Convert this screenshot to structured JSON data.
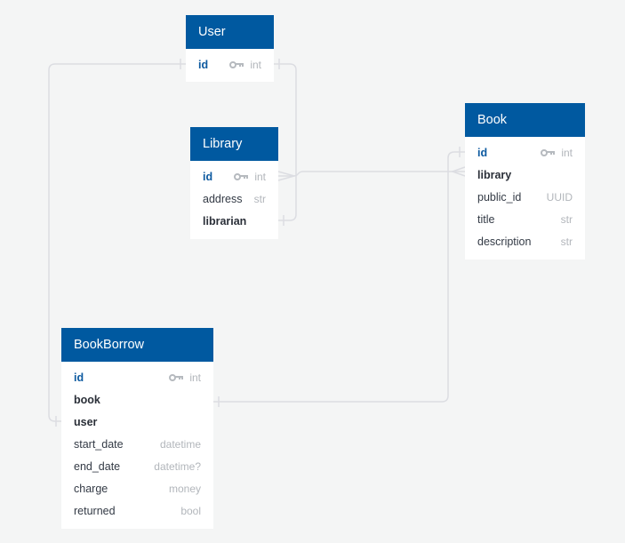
{
  "colors": {
    "header_bg": "#0059a0",
    "header_text": "#ffffff",
    "primary_key_text": "#0d5aa0",
    "type_text": "#b2b6bb",
    "connector": "#dcdde2",
    "canvas_bg": "#f4f5f5"
  },
  "tables": {
    "user": {
      "title": "User",
      "fields": [
        {
          "name": "id",
          "type": "int",
          "pk": true
        }
      ]
    },
    "library": {
      "title": "Library",
      "fields": [
        {
          "name": "id",
          "type": "int",
          "pk": true
        },
        {
          "name": "address",
          "type": "str"
        },
        {
          "name": "librarian",
          "type": "",
          "fk": true
        }
      ]
    },
    "book": {
      "title": "Book",
      "fields": [
        {
          "name": "id",
          "type": "int",
          "pk": true
        },
        {
          "name": "library",
          "type": "",
          "fk": true
        },
        {
          "name": "public_id",
          "type": "UUID"
        },
        {
          "name": "title",
          "type": "str"
        },
        {
          "name": "description",
          "type": "str"
        }
      ]
    },
    "bookborrow": {
      "title": "BookBorrow",
      "fields": [
        {
          "name": "id",
          "type": "int",
          "pk": true
        },
        {
          "name": "book",
          "type": "",
          "fk": true
        },
        {
          "name": "user",
          "type": "",
          "fk": true
        },
        {
          "name": "start_date",
          "type": "datetime"
        },
        {
          "name": "end_date",
          "type": "datetime?"
        },
        {
          "name": "charge",
          "type": "money"
        },
        {
          "name": "returned",
          "type": "bool"
        }
      ]
    }
  },
  "relationships": [
    {
      "from": "User.id",
      "to": "BookBorrow.user",
      "from_end": "one",
      "to_end": "one"
    },
    {
      "from": "User.id",
      "to": "Library.librarian",
      "from_end": "one",
      "to_end": "one"
    },
    {
      "from": "Library.id",
      "to": "Book.library",
      "from_end": "many",
      "to_end": "many"
    },
    {
      "from": "Book.id",
      "to": "BookBorrow.book",
      "from_end": "one",
      "to_end": "one"
    }
  ]
}
